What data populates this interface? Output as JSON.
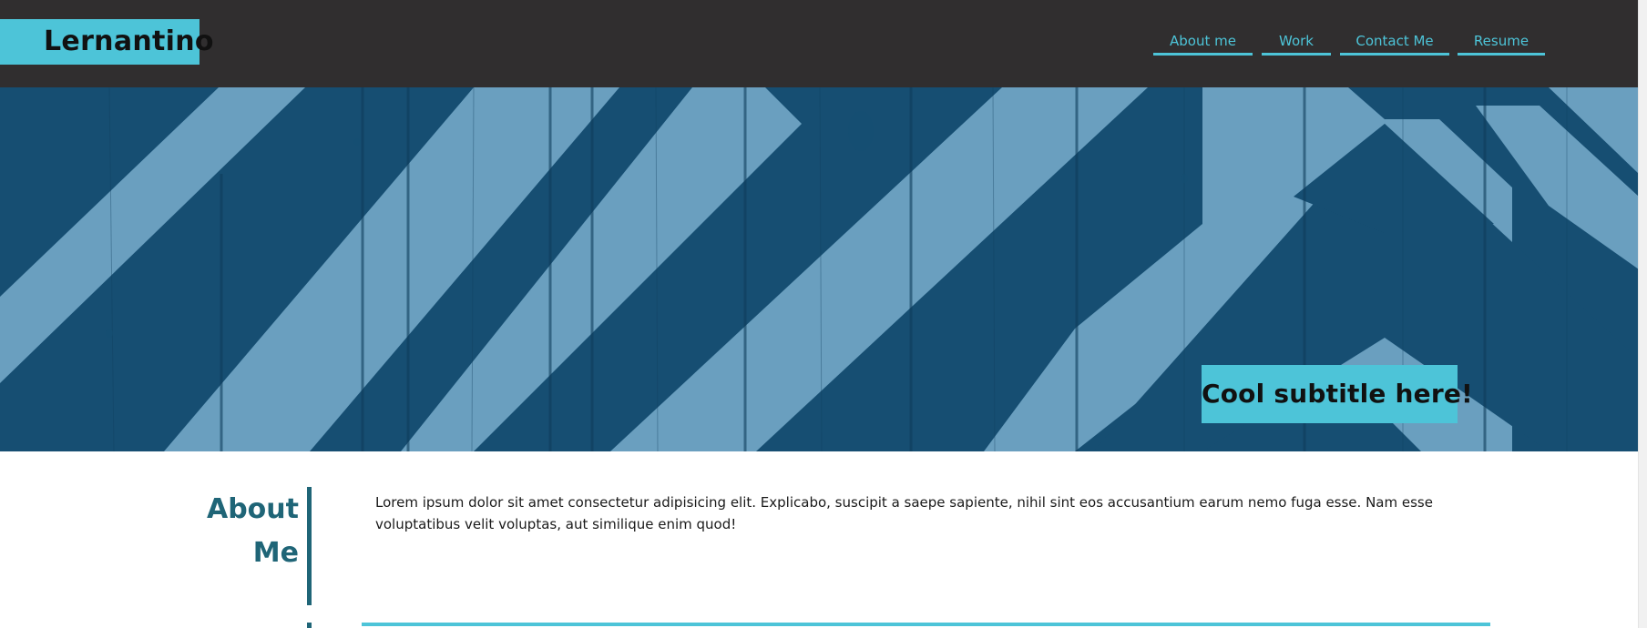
{
  "site": {
    "logo": "Lernantino"
  },
  "nav": {
    "items": [
      {
        "label": "About me"
      },
      {
        "label": "Work"
      },
      {
        "label": "Contact Me"
      },
      {
        "label": "Resume"
      }
    ]
  },
  "hero": {
    "subtitle": "Cool subtitle here!"
  },
  "about": {
    "heading_line1": "About",
    "heading_line2": "Me",
    "body": "Lorem ipsum dolor sit amet consectetur adipisicing elit. Explicabo, suscipit a saepe sapiente, nihil sint eos accusantium earum nemo fuga esse. Nam esse voluptatibus velit voluptas, aut similique enim quod!"
  },
  "colors": {
    "header_bg": "#302e2f",
    "accent": "#4dc4d8",
    "hero_dark": "#164e72",
    "hero_light": "#6a9fbf",
    "section_heading": "#1f6577"
  }
}
